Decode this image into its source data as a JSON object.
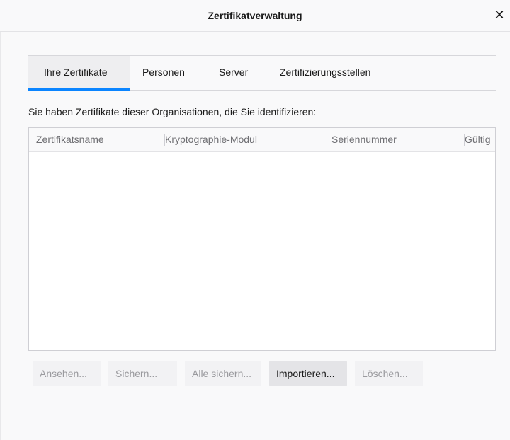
{
  "dialog": {
    "title": "Zertifikatverwaltung",
    "close_glyph": "✕",
    "close_icon": "close-icon"
  },
  "tabs": [
    {
      "label": "Ihre Zertifikate",
      "active": true
    },
    {
      "label": "Personen",
      "active": false
    },
    {
      "label": "Server",
      "active": false
    },
    {
      "label": "Zertifizierungsstellen",
      "active": false
    }
  ],
  "description": "Sie haben Zertifikate dieser Organisationen, die Sie identifizieren:",
  "table": {
    "columns": [
      "Zertifikatsname",
      "Kryptographie-Modul",
      "Seriennummer",
      "Gültig"
    ],
    "rows": []
  },
  "buttons": [
    {
      "label": "Ansehen...",
      "enabled": false
    },
    {
      "label": "Sichern...",
      "enabled": false
    },
    {
      "label": "Alle sichern...",
      "enabled": false
    },
    {
      "label": "Importieren...",
      "enabled": true
    },
    {
      "label": "Löschen...",
      "enabled": false
    }
  ],
  "colors": {
    "accent": "#0a84ff",
    "background": "#f9f9fa"
  }
}
